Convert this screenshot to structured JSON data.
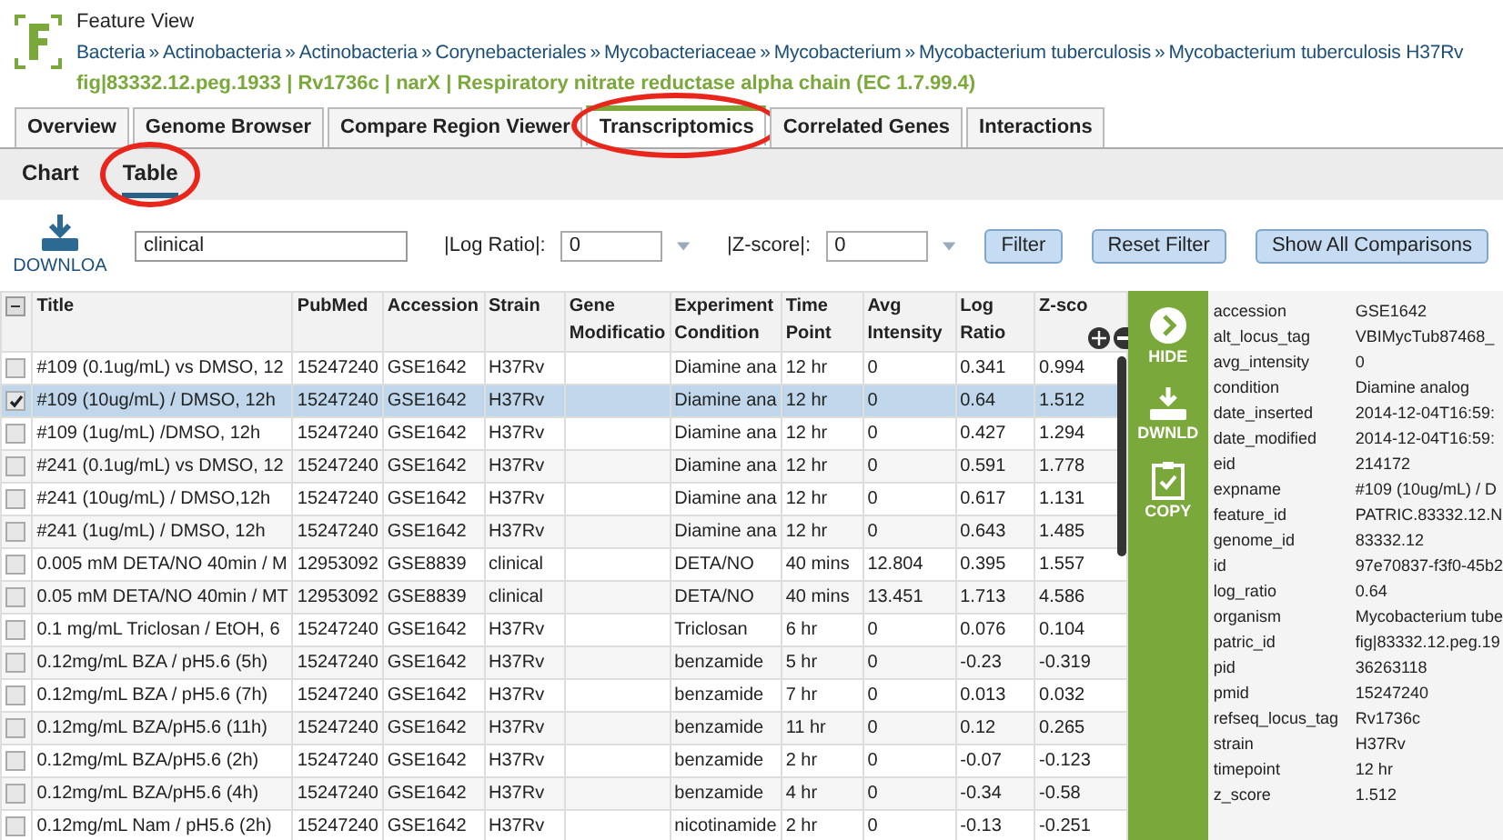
{
  "header": {
    "title": "Feature View",
    "breadcrumb": [
      "Bacteria",
      "Actinobacteria",
      "Actinobacteria",
      "Corynebacteriales",
      "Mycobacteriaceae",
      "Mycobacterium",
      "Mycobacterium tuberculosis",
      "Mycobacterium tuberculosis H37Rv"
    ],
    "separator": "»",
    "feature": "fig|83332.12.peg.1933 | Rv1736c | narX | Respiratory nitrate reductase alpha chain (EC 1.7.99.4)"
  },
  "tabs": [
    {
      "label": "Overview",
      "selected": false,
      "circled": false
    },
    {
      "label": "Genome Browser",
      "selected": false,
      "circled": false
    },
    {
      "label": "Compare Region Viewer",
      "selected": false,
      "circled": false
    },
    {
      "label": "Transcriptomics",
      "selected": true,
      "circled": true
    },
    {
      "label": "Correlated Genes",
      "selected": false,
      "circled": false
    },
    {
      "label": "Interactions",
      "selected": false,
      "circled": false
    }
  ],
  "subtabs": [
    {
      "label": "Chart",
      "selected": false,
      "circled": false
    },
    {
      "label": "Table",
      "selected": true,
      "circled": true
    }
  ],
  "toolbar": {
    "download": "DOWNLOA",
    "keyword": "clinical",
    "log_ratio_label": "|Log Ratio|:",
    "log_ratio": "0",
    "zscore_label": "|Z-score|:",
    "zscore": "0",
    "buttons": [
      "Filter",
      "Reset Filter",
      "Show All Comparisons"
    ]
  },
  "table": {
    "header_checkbox": {
      "indeterminate": true
    },
    "columns": [
      "Title",
      "PubMed",
      "Accession",
      "Strain",
      "Gene Modificatio",
      "Experiment Condition",
      "Time Point",
      "Avg Intensity",
      "Log Ratio",
      "Z-sco"
    ],
    "rows": [
      {
        "selected": false,
        "cells": [
          "#109 (0.1ug/mL) vs DMSO, 12",
          "15247240",
          "GSE1642",
          "H37Rv",
          "",
          "Diamine ana",
          "12 hr",
          "0",
          "0.341",
          "0.994"
        ]
      },
      {
        "selected": true,
        "cells": [
          "#109 (10ug/mL) / DMSO, 12h",
          "15247240",
          "GSE1642",
          "H37Rv",
          "",
          "Diamine ana",
          "12 hr",
          "0",
          "0.64",
          "1.512"
        ]
      },
      {
        "selected": false,
        "cells": [
          "#109 (1ug/mL) /DMSO, 12h",
          "15247240",
          "GSE1642",
          "H37Rv",
          "",
          "Diamine ana",
          "12 hr",
          "0",
          "0.427",
          "1.294"
        ]
      },
      {
        "selected": false,
        "cells": [
          "#241 (0.1ug/mL) vs DMSO, 12",
          "15247240",
          "GSE1642",
          "H37Rv",
          "",
          "Diamine ana",
          "12 hr",
          "0",
          "0.591",
          "1.778"
        ]
      },
      {
        "selected": false,
        "cells": [
          "#241 (10ug/mL) / DMSO,12h",
          "15247240",
          "GSE1642",
          "H37Rv",
          "",
          "Diamine ana",
          "12 hr",
          "0",
          "0.617",
          "1.131"
        ]
      },
      {
        "selected": false,
        "cells": [
          "#241 (1ug/mL) / DMSO, 12h",
          "15247240",
          "GSE1642",
          "H37Rv",
          "",
          "Diamine ana",
          "12 hr",
          "0",
          "0.643",
          "1.485"
        ]
      },
      {
        "selected": false,
        "cells": [
          "0.005 mM DETA/NO 40min / M",
          "12953092",
          "GSE8839",
          "clinical",
          "",
          "DETA/NO",
          "40 mins",
          "12.804",
          "0.395",
          "1.557"
        ]
      },
      {
        "selected": false,
        "cells": [
          "0.05 mM DETA/NO 40min / MT",
          "12953092",
          "GSE8839",
          "clinical",
          "",
          "DETA/NO",
          "40 mins",
          "13.451",
          "1.713",
          "4.586"
        ]
      },
      {
        "selected": false,
        "cells": [
          "0.1 mg/mL Triclosan / EtOH, 6",
          "15247240",
          "GSE1642",
          "H37Rv",
          "",
          "Triclosan",
          "6 hr",
          "0",
          "0.076",
          "0.104"
        ]
      },
      {
        "selected": false,
        "cells": [
          "0.12mg/mL BZA / pH5.6 (5h)",
          "15247240",
          "GSE1642",
          "H37Rv",
          "",
          "benzamide",
          "5 hr",
          "0",
          "-0.23",
          "-0.319"
        ]
      },
      {
        "selected": false,
        "cells": [
          "0.12mg/mL BZA / pH5.6 (7h)",
          "15247240",
          "GSE1642",
          "H37Rv",
          "",
          "benzamide",
          "7 hr",
          "0",
          "0.013",
          "0.032"
        ]
      },
      {
        "selected": false,
        "cells": [
          "0.12mg/mL BZA/pH5.6 (11h)",
          "15247240",
          "GSE1642",
          "H37Rv",
          "",
          "benzamide",
          "11 hr",
          "0",
          "0.12",
          "0.265"
        ]
      },
      {
        "selected": false,
        "cells": [
          "0.12mg/mL BZA/pH5.6 (2h)",
          "15247240",
          "GSE1642",
          "H37Rv",
          "",
          "benzamide",
          "2 hr",
          "0",
          "-0.07",
          "-0.123"
        ]
      },
      {
        "selected": false,
        "cells": [
          "0.12mg/mL BZA/pH5.6 (4h)",
          "15247240",
          "GSE1642",
          "H37Rv",
          "",
          "benzamide",
          "4 hr",
          "0",
          "-0.34",
          "-0.58"
        ]
      },
      {
        "selected": false,
        "cells": [
          "0.12mg/mL Nam / pH5.6 (2h)",
          "15247240",
          "GSE1642",
          "H37Rv",
          "",
          "nicotinamide",
          "2 hr",
          "0",
          "-0.13",
          "-0.251"
        ]
      }
    ]
  },
  "side_actions": [
    {
      "kind": "hide",
      "label": "HIDE"
    },
    {
      "kind": "download",
      "label": "DWNLD"
    },
    {
      "kind": "copy",
      "label": "COPY"
    }
  ],
  "details": [
    {
      "key": "accession",
      "value": "GSE1642"
    },
    {
      "key": "alt_locus_tag",
      "value": "VBIMycTub87468_"
    },
    {
      "key": "avg_intensity",
      "value": "0"
    },
    {
      "key": "condition",
      "value": "Diamine analog"
    },
    {
      "key": "date_inserted",
      "value": "2014-12-04T16:59:"
    },
    {
      "key": "date_modified",
      "value": "2014-12-04T16:59:"
    },
    {
      "key": "eid",
      "value": "214172"
    },
    {
      "key": "expname",
      "value": "#109 (10ug/mL) / D"
    },
    {
      "key": "feature_id",
      "value": "PATRIC.83332.12.N"
    },
    {
      "key": "genome_id",
      "value": "83332.12"
    },
    {
      "key": "id",
      "value": "97e70837-f3f0-45b2"
    },
    {
      "key": "log_ratio",
      "value": "0.64"
    },
    {
      "key": "organism",
      "value": "Mycobacterium tube"
    },
    {
      "key": "patric_id",
      "value": "fig|83332.12.peg.19"
    },
    {
      "key": "pid",
      "value": "36263118"
    },
    {
      "key": "pmid",
      "value": "15247240"
    },
    {
      "key": "refseq_locus_tag",
      "value": "Rv1736c"
    },
    {
      "key": "strain",
      "value": "H37Rv"
    },
    {
      "key": "timepoint",
      "value": "12 hr"
    },
    {
      "key": "z_score",
      "value": "1.512"
    }
  ]
}
